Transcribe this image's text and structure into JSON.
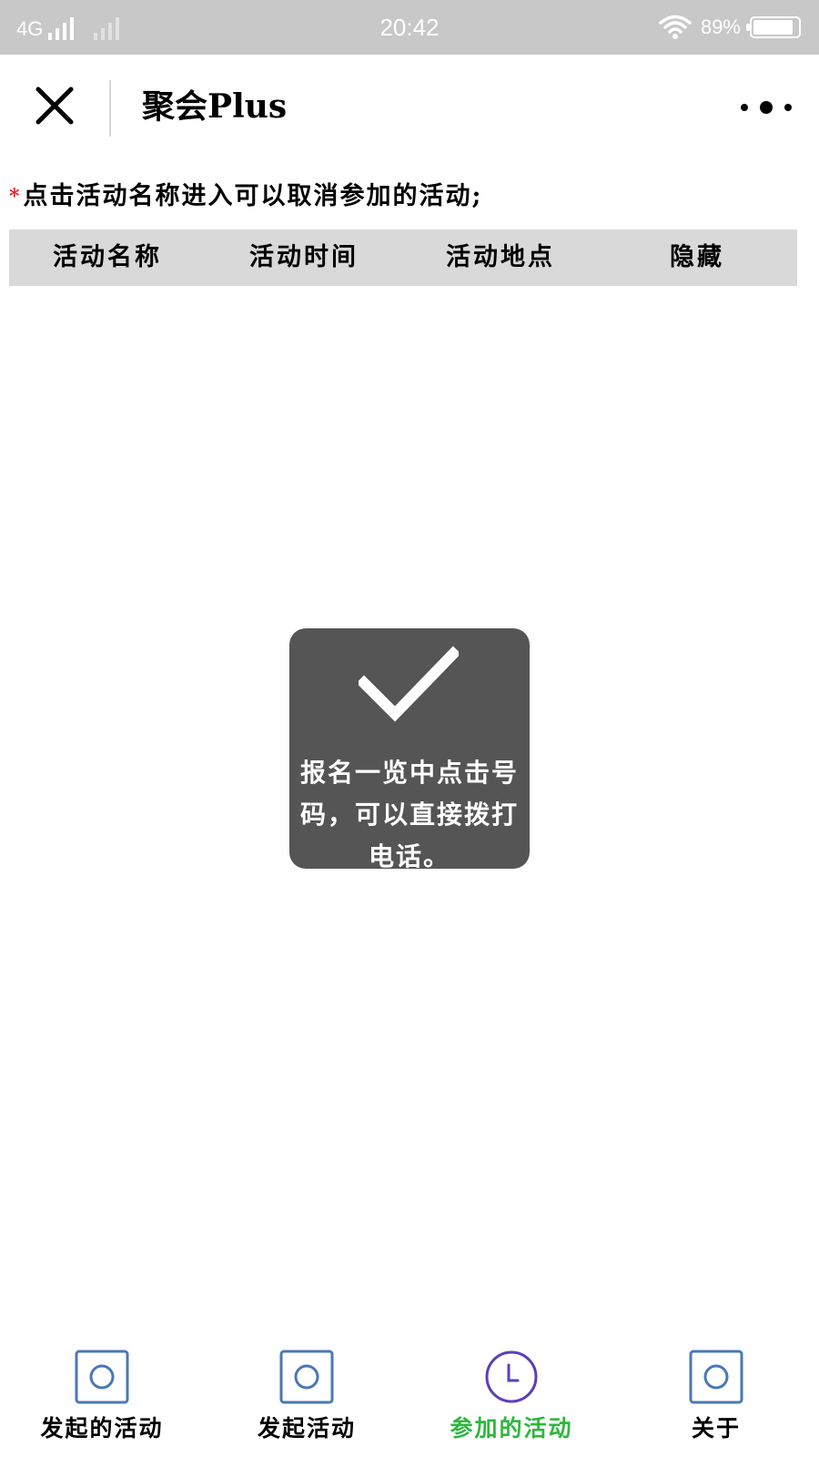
{
  "status_bar": {
    "network": "4G",
    "time": "20:42",
    "battery": "89%",
    "battery_level": 0.89
  },
  "nav": {
    "title": "聚会Plus"
  },
  "hint": {
    "star": "*",
    "text": "点击活动名称进入可以取消参加的活动;"
  },
  "table": {
    "headers": [
      "活动名称",
      "活动时间",
      "活动地点",
      "隐藏"
    ]
  },
  "toast": {
    "icon": "checkmark-icon",
    "message": "报名一览中点击号码，可以直接拨打电话。"
  },
  "tabs": [
    {
      "label": "发起的活动",
      "icon": "square-circle-icon",
      "active": false
    },
    {
      "label": "发起活动",
      "icon": "square-circle-icon",
      "active": false
    },
    {
      "label": "参加的活动",
      "icon": "clock-icon",
      "active": true
    },
    {
      "label": "关于",
      "icon": "square-circle-icon",
      "active": false
    }
  ],
  "colors": {
    "status_bar_bg": "#c8c8c8",
    "accent_active": "#2db73d",
    "hint_star": "#e02020",
    "table_header_bg": "#d9d9d9",
    "toast_bg": "#555555",
    "tab_icon_blue": "#4a78b5",
    "tab_icon_purple": "#5b3fb8"
  }
}
